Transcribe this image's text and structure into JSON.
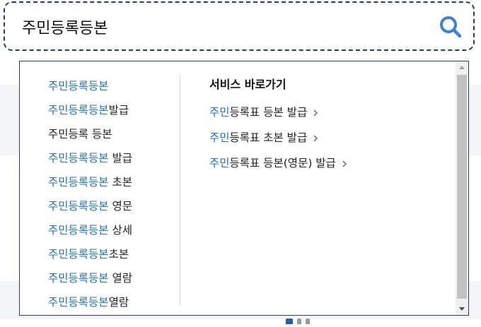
{
  "search": {
    "value": "주민등록등본",
    "placeholder": ""
  },
  "suggestions": [
    {
      "match": "주민등록등본",
      "rest": ""
    },
    {
      "match": "주민등록등본",
      "rest": "발급"
    },
    {
      "match": "",
      "rest": "주민등록 등본"
    },
    {
      "match": "주민등록등본",
      "rest": " 발급"
    },
    {
      "match": "주민등록등본",
      "rest": " 초본"
    },
    {
      "match": "주민등록등본",
      "rest": " 영문"
    },
    {
      "match": "주민등록등본",
      "rest": " 상세"
    },
    {
      "match": "주민등록등본",
      "rest": "초본"
    },
    {
      "match": "주민등록등본",
      "rest": " 열람"
    },
    {
      "match": "주민등록등본",
      "rest": "열람"
    }
  ],
  "service": {
    "title": "서비스 바로가기",
    "items": [
      {
        "match": "주민",
        "rest": "등록표 등본 발급"
      },
      {
        "match": "주민",
        "rest": "등록표 초본 발급"
      },
      {
        "match": "주민",
        "rest": "등록표 등본(영문) 발급"
      }
    ]
  },
  "colors": {
    "highlight": "#1f6fc5",
    "border": "#1f3f6e",
    "search_icon": "#3b82d6"
  },
  "icons": {
    "search": "search-icon",
    "chevron": "chevron-right-icon",
    "scroll_up": "scroll-up-arrow-icon",
    "scroll_down": "scroll-down-arrow-icon"
  }
}
